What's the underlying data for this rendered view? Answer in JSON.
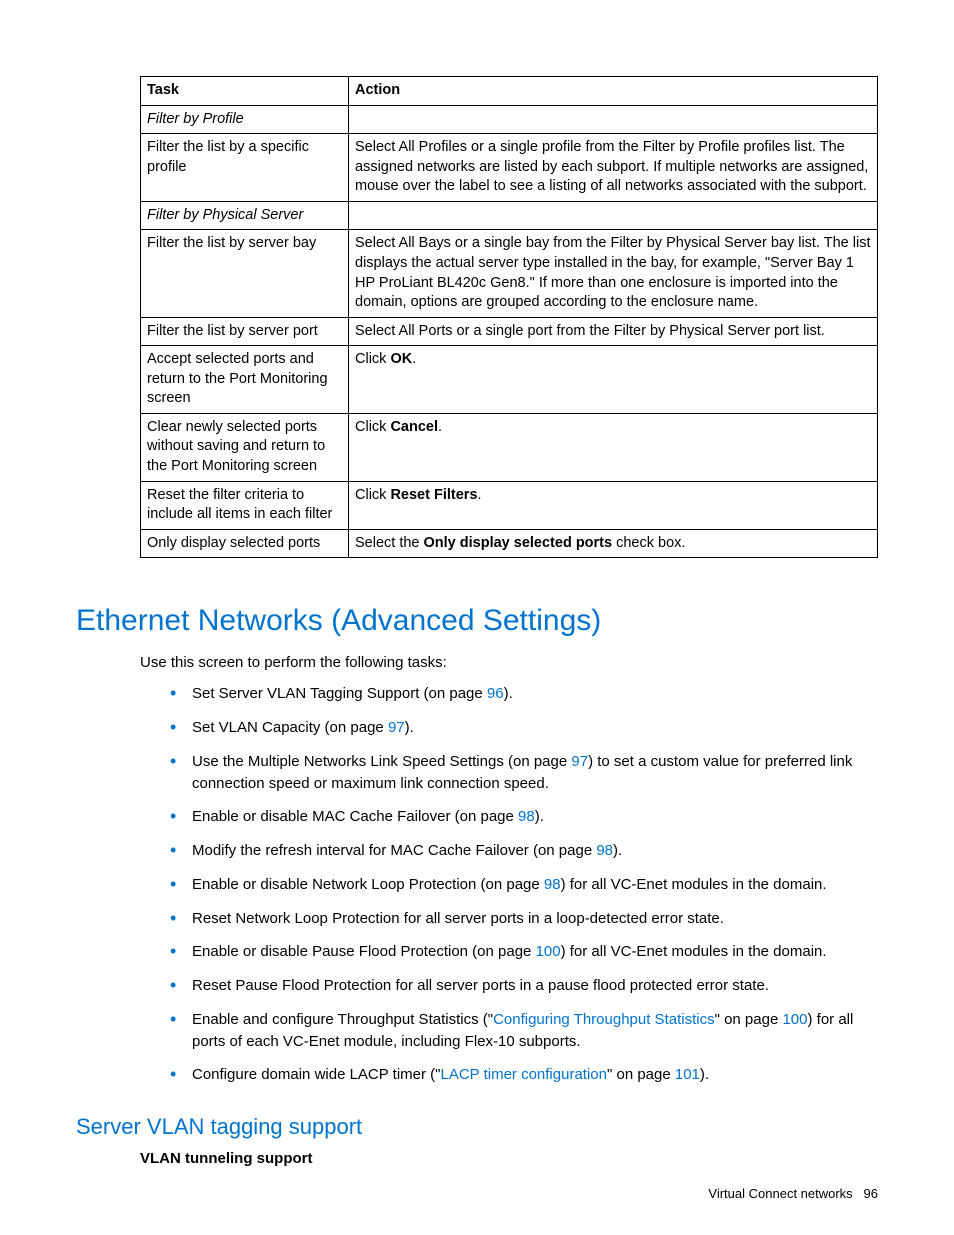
{
  "tableHeaders": {
    "task": "Task",
    "action": "Action"
  },
  "rows": {
    "r0": {
      "task": "Filter by Profile",
      "action": ""
    },
    "r1": {
      "task": "Filter the list by a specific profile",
      "action": "Select All Profiles or a single profile from the Filter by Profile profiles list. The assigned networks are listed by each subport. If multiple networks are assigned, mouse over the label to see a listing of all networks associated with the subport."
    },
    "r2": {
      "task": "Filter by Physical Server",
      "action": ""
    },
    "r3": {
      "task": "Filter the list by server bay",
      "action": "Select All Bays or a single bay from the Filter by Physical Server bay list. The list displays the actual server type installed in the bay, for example, \"Server Bay 1 HP ProLiant BL420c Gen8.\" If more than one enclosure is imported into the domain, options are grouped according to the enclosure name."
    },
    "r4": {
      "task": "Filter the list by server port",
      "action": "Select All Ports or a single port from the Filter by Physical Server port list."
    },
    "r5": {
      "task": "Accept selected ports and return to the Port Monitoring screen",
      "actionPre": "Click ",
      "actionBold": "OK",
      "actionPost": "."
    },
    "r6": {
      "task": "Clear newly selected ports without saving and return to the Port Monitoring screen",
      "actionPre": "Click ",
      "actionBold": "Cancel",
      "actionPost": "."
    },
    "r7": {
      "task": "Reset the filter criteria to include all items in each filter",
      "actionPre": "Click ",
      "actionBold": "Reset Filters",
      "actionPost": "."
    },
    "r8": {
      "task": "Only display selected ports",
      "actionPre": "Select the ",
      "actionBold": "Only display selected ports",
      "actionPost": " check box."
    }
  },
  "section": {
    "heading": "Ethernet Networks (Advanced Settings)",
    "intro": "Use this screen to perform the following tasks:"
  },
  "bullets": {
    "b0": {
      "pre": "Set Server VLAN Tagging Support (on page ",
      "link": "96",
      "post": ")."
    },
    "b1": {
      "pre": "Set VLAN Capacity (on page ",
      "link": "97",
      "post": ")."
    },
    "b2": {
      "pre": "Use the Multiple Networks Link Speed Settings (on page ",
      "link": "97",
      "post": ") to set a custom value for preferred link connection speed or maximum link connection speed."
    },
    "b3": {
      "pre": "Enable or disable MAC Cache Failover (on page ",
      "link": "98",
      "post": ")."
    },
    "b4": {
      "pre": "Modify the refresh interval for MAC Cache Failover (on page ",
      "link": "98",
      "post": ")."
    },
    "b5": {
      "pre": "Enable or disable Network Loop Protection (on page ",
      "link": "98",
      "post": ") for all VC-Enet modules in the domain."
    },
    "b6": {
      "text": "Reset Network Loop Protection for all server ports in a loop-detected error state."
    },
    "b7": {
      "pre": "Enable or disable Pause Flood Protection (on page ",
      "link": "100",
      "post": ") for all VC-Enet modules in the domain."
    },
    "b8": {
      "text": "Reset Pause Flood Protection for all server ports in a pause flood protected error state."
    },
    "b9": {
      "pre": "Enable and configure Throughput Statistics (\"",
      "link1": "Configuring Throughput Statistics",
      "mid": "\" on page ",
      "link2": "100",
      "post": ") for all ports of each VC-Enet module, including Flex-10 subports."
    },
    "b10": {
      "pre": "Configure domain wide LACP timer (\"",
      "link1": "LACP timer configuration",
      "mid": "\" on page ",
      "link2": "101",
      "post": ")."
    }
  },
  "subsection": {
    "heading": "Server VLAN tagging support",
    "bold": "VLAN tunneling support"
  },
  "footer": {
    "text": "Virtual Connect networks",
    "page": "96"
  }
}
